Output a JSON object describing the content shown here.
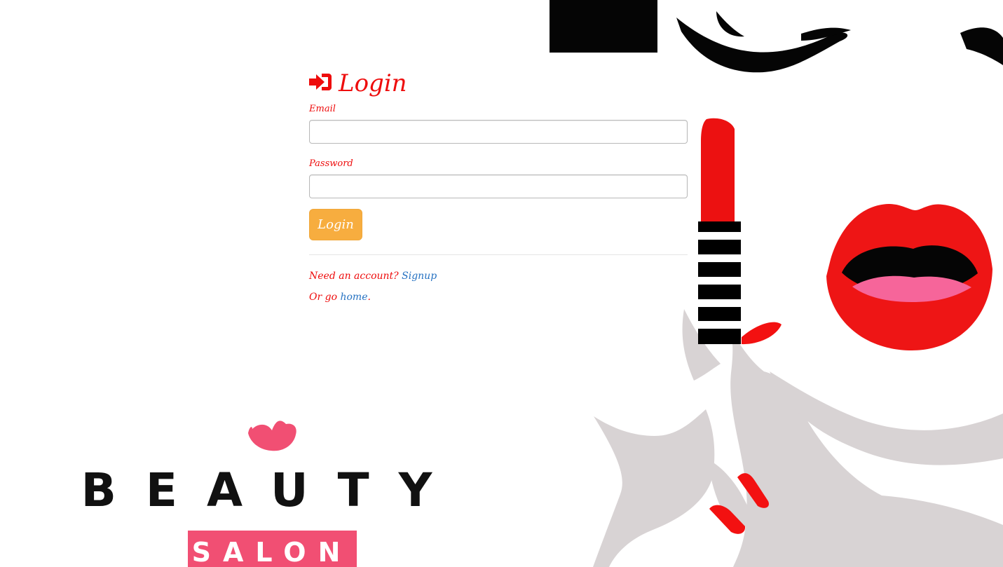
{
  "page": {
    "title": "Login"
  },
  "form": {
    "email_label": "Email",
    "email_value": "",
    "email_placeholder": "",
    "password_label": "Password",
    "password_value": "",
    "password_placeholder": "",
    "submit_label": "Login"
  },
  "footer": {
    "account_prompt": "Need an account?",
    "signup_link": "Signup",
    "home_prefix": "Or go",
    "home_link": "home",
    "home_suffix": "."
  },
  "branding": {
    "beauty_text": "BEAUTY",
    "salon_text": "SALON"
  },
  "colors": {
    "accent_red": "#ee0c0c",
    "button_orange": "#f7ad3f",
    "link_blue": "#2672c2",
    "salon_pink": "#f14f73",
    "art_grey": "#d8d3d4"
  },
  "icons": {
    "title_icon": "sign-in-icon"
  }
}
